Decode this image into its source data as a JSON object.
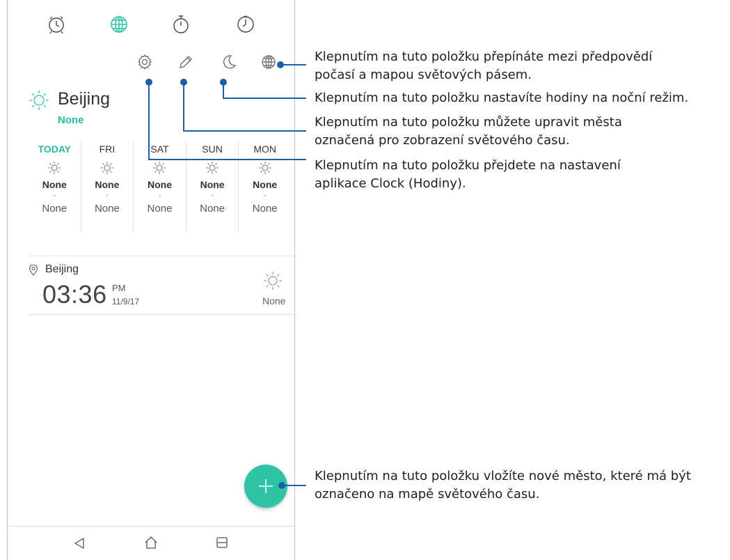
{
  "tabs": [
    {
      "icon": "alarm-icon"
    },
    {
      "icon": "world-clock-icon",
      "active": true
    },
    {
      "icon": "stopwatch-icon"
    },
    {
      "icon": "timer-icon"
    }
  ],
  "actions": [
    {
      "icon": "settings-icon"
    },
    {
      "icon": "edit-icon"
    },
    {
      "icon": "night-mode-icon"
    },
    {
      "icon": "globe-icon"
    }
  ],
  "city": {
    "name": "Beijing",
    "status": "None"
  },
  "forecast": [
    {
      "day": "TODAY",
      "high": "None",
      "low": "None"
    },
    {
      "day": "FRI",
      "high": "None",
      "low": "None"
    },
    {
      "day": "SAT",
      "high": "None",
      "low": "None"
    },
    {
      "day": "SUN",
      "high": "None",
      "low": "None"
    },
    {
      "day": "MON",
      "high": "None",
      "low": "None"
    }
  ],
  "world_clock": {
    "city": "Beijing",
    "time": "03:36",
    "ampm": "PM",
    "date": "11/9/17",
    "weather": "None"
  },
  "fab": {
    "icon": "add-icon"
  },
  "nav": [
    {
      "icon": "back-icon"
    },
    {
      "icon": "home-icon"
    },
    {
      "icon": "recents-icon"
    }
  ],
  "callouts": {
    "globe": [
      "Klepnutím na tuto položku přepínáte mezi předpovědí",
      "počasí a mapou světových pásem."
    ],
    "night": [
      "Klepnutím na tuto položku nastavíte hodiny na noční režim."
    ],
    "edit": [
      "Klepnutím na tuto položku můžete upravit města",
      "označená pro zobrazení světového času."
    ],
    "settings": [
      "Klepnutím na tuto položku přejdete na nastavení",
      "aplikace Clock (Hodiny)."
    ],
    "add": [
      "Klepnutím na tuto položku vložíte nové město, které má být",
      "označeno na mapě světového času."
    ]
  },
  "colors": {
    "accent": "#2ec4a4",
    "callout_line": "#1a5fa8"
  }
}
